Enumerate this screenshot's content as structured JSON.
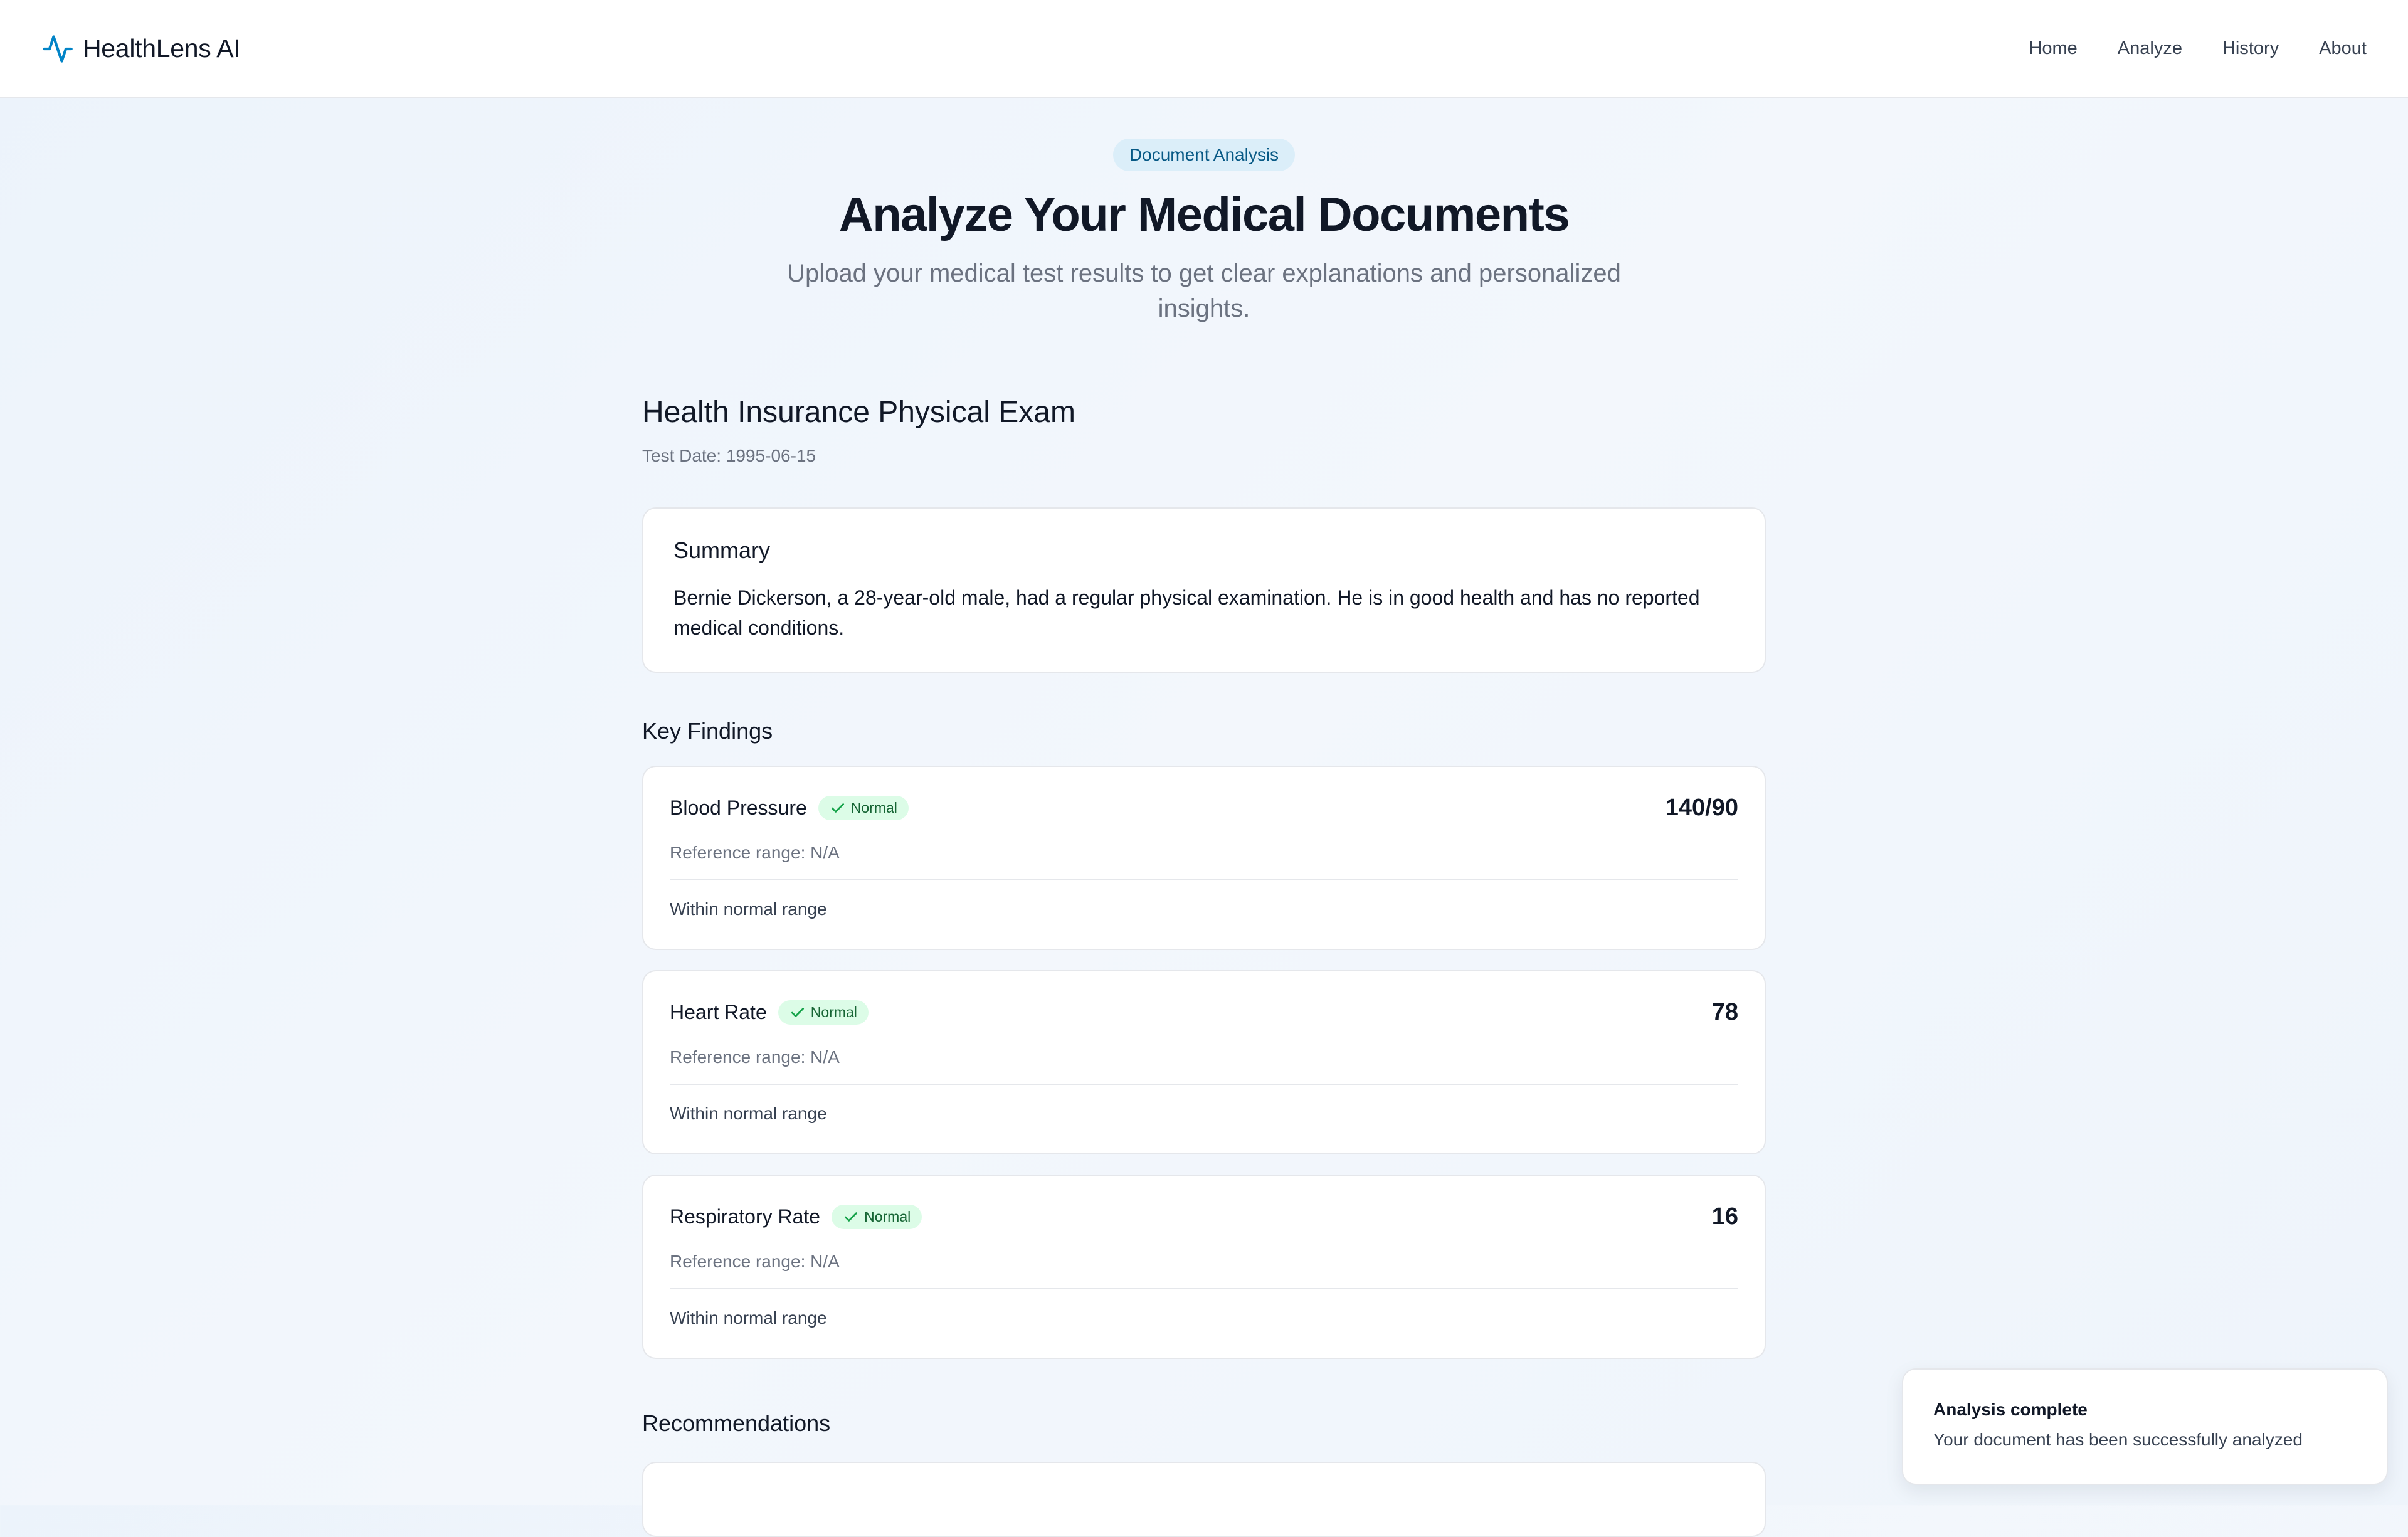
{
  "header": {
    "brand": "HealthLens AI",
    "nav": [
      "Home",
      "Analyze",
      "History",
      "About"
    ]
  },
  "hero": {
    "badge": "Document Analysis",
    "title": "Analyze Your Medical Documents",
    "subtitle": "Upload your medical test results to get clear explanations and personalized insights."
  },
  "document": {
    "title": "Health Insurance Physical Exam",
    "date": "Test Date: 1995-06-15"
  },
  "summary": {
    "heading": "Summary",
    "text": "Bernie Dickerson, a 28-year-old male, had a regular physical examination. He is in good health and has no reported medical conditions."
  },
  "findings": {
    "heading": "Key Findings",
    "items": [
      {
        "name": "Blood Pressure",
        "status": "Normal",
        "value": "140/90",
        "reference": "Reference range: N/A",
        "note": "Within normal range"
      },
      {
        "name": "Heart Rate",
        "status": "Normal",
        "value": "78",
        "reference": "Reference range: N/A",
        "note": "Within normal range"
      },
      {
        "name": "Respiratory Rate",
        "status": "Normal",
        "value": "16",
        "reference": "Reference range: N/A",
        "note": "Within normal range"
      }
    ]
  },
  "recommendations": {
    "heading": "Recommendations"
  },
  "toast": {
    "title": "Analysis complete",
    "message": "Your document has been successfully analyzed"
  },
  "colors": {
    "accent": "#0284c7",
    "success_bg": "#dcfce7",
    "success_text": "#166534"
  },
  "icons": {
    "brand": "activity-pulse-icon",
    "status": "check-icon"
  }
}
